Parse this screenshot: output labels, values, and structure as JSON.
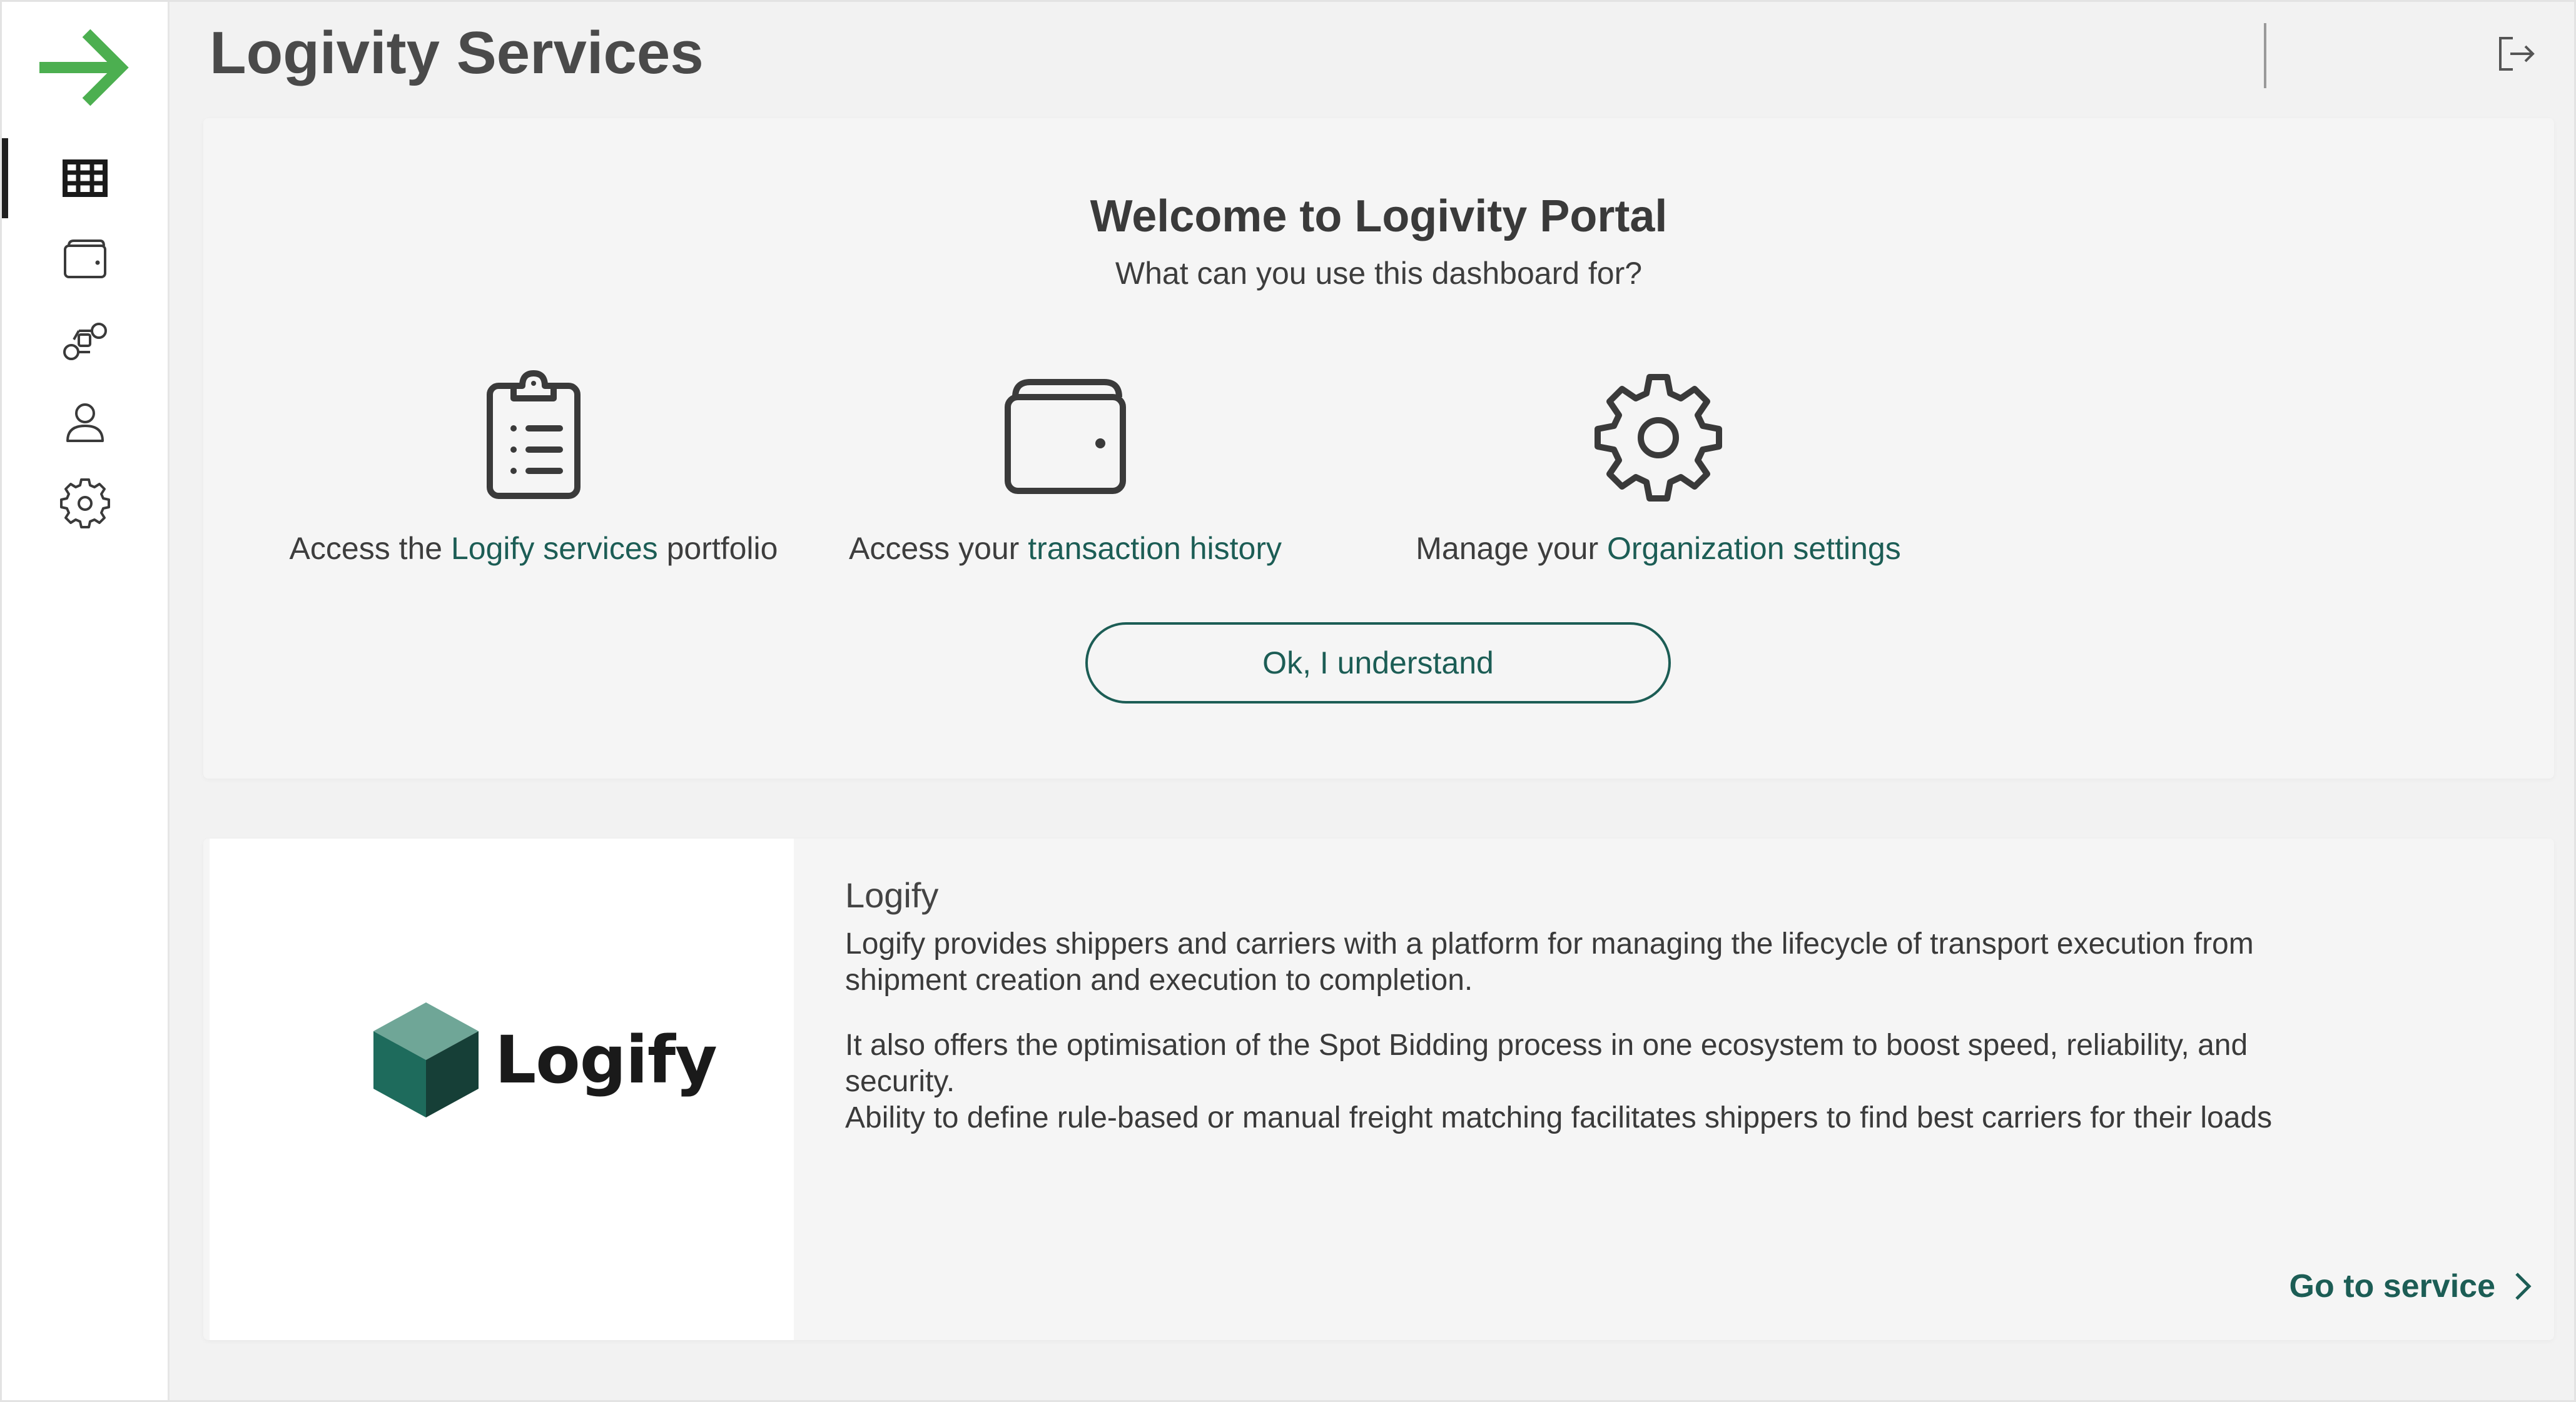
{
  "header": {
    "title": "Logivity Services"
  },
  "sidebar": {
    "items": [
      {
        "name": "grid-icon",
        "active": true
      },
      {
        "name": "wallet-icon",
        "active": false
      },
      {
        "name": "connections-icon",
        "active": false
      },
      {
        "name": "user-icon",
        "active": false
      },
      {
        "name": "gear-icon",
        "active": false
      }
    ]
  },
  "welcome": {
    "title": "Welcome to Logivity Portal",
    "subtitle": "What can you use this dashboard for?",
    "features": [
      {
        "icon": "clipboard-icon",
        "prefix": "Access the ",
        "link": "Logify services",
        "suffix": " portfolio"
      },
      {
        "icon": "wallet-icon",
        "prefix": "Access your ",
        "link": "transaction history",
        "suffix": ""
      },
      {
        "icon": "gear-icon",
        "prefix": "Manage your ",
        "link": "Organization settings",
        "suffix": ""
      }
    ],
    "button_label": "Ok, I understand"
  },
  "service": {
    "logo_text": "Logify",
    "name": "Logify",
    "description_1": "Logify provides shippers and carriers with a platform for managing the lifecycle of transport execution from shipment creation and execution to completion.",
    "description_2": "It also offers the optimisation of the Spot Bidding process in one ecosystem to boost speed, reliability, and security.",
    "description_3": "Ability to define rule-based or manual freight matching facilitates shippers to find best carriers for their loads",
    "cta_label": "Go to service"
  },
  "colors": {
    "accent": "#1c5d55",
    "logo_green": "#4caf50",
    "active_indicator": "#1f1f1f",
    "cube_top": "#6fa697",
    "cube_left": "#1e6b5c",
    "cube_right": "#163f37"
  }
}
